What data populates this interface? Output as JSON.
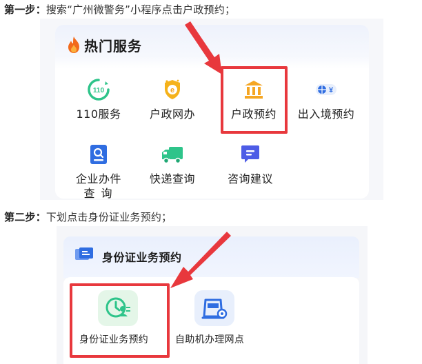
{
  "step1": {
    "prefix": "第一步：",
    "text": "搜索“广州微警务”小程序点击户政预约；"
  },
  "hot_services": {
    "title": "热门服务",
    "items": [
      {
        "label": "110服务",
        "icon": "110-icon",
        "color": "#2ec48a"
      },
      {
        "label": "户政网办",
        "icon": "household-online-icon",
        "color": "#f5b21b"
      },
      {
        "label": "户政预约",
        "icon": "government-building-icon",
        "color": "#f5a623"
      },
      {
        "label": "出入境预约",
        "icon": "passport-exchange-icon",
        "color": "#2f6de1"
      },
      {
        "label": "企业办件",
        "label_line2": "查 询",
        "icon": "enterprise-search-icon",
        "color": "#2f6de1"
      },
      {
        "label": "快递查询",
        "icon": "delivery-truck-icon",
        "color": "#2ec48a"
      },
      {
        "label": "咨询建议",
        "icon": "chat-icon",
        "color": "#4d5ce6"
      }
    ]
  },
  "step2": {
    "prefix": "第二步：",
    "text": "下划点击身份证业务预约；"
  },
  "id_section": {
    "title": "身份证业务预约",
    "items": [
      {
        "label": "身份证业务预约",
        "icon": "id-appointment-icon",
        "color": "#2ec48a"
      },
      {
        "label": "自助机办理网点",
        "icon": "kiosk-location-icon",
        "color": "#2f6de1"
      }
    ]
  },
  "colors": {
    "highlight": "#e8383d",
    "arrow": "#e8383d"
  }
}
